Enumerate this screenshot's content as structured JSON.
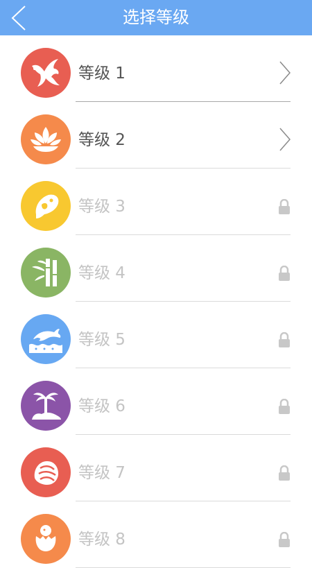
{
  "header": {
    "title": "选择等级",
    "back_icon": "chevron-left-icon",
    "background": "#6aa8f2"
  },
  "levels": [
    {
      "label": "等级 1",
      "icon": "phoenix-icon",
      "color": "#e85e52",
      "state": "unlocked"
    },
    {
      "label": "等级 2",
      "icon": "lotus-icon",
      "color": "#f58a4b",
      "state": "unlocked"
    },
    {
      "label": "等级 3",
      "icon": "bird-icon",
      "color": "#f8c830",
      "state": "locked"
    },
    {
      "label": "等级 4",
      "icon": "bamboo-icon",
      "color": "#8ab564",
      "state": "locked"
    },
    {
      "label": "等级 5",
      "icon": "dolphin-icon",
      "color": "#67a8f2",
      "state": "locked"
    },
    {
      "label": "等级 6",
      "icon": "palm-tree-icon",
      "color": "#8b54a8",
      "state": "locked"
    },
    {
      "label": "等级 7",
      "icon": "shell-icon",
      "color": "#e85e52",
      "state": "locked"
    },
    {
      "label": "等级 8",
      "icon": "hatching-chick-icon",
      "color": "#f58a4b",
      "state": "locked"
    }
  ]
}
